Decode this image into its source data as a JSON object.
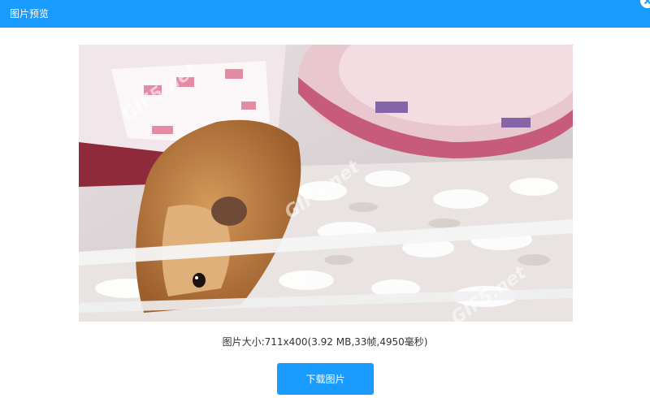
{
  "header": {
    "title": "图片预览"
  },
  "preview": {
    "watermark": "GIF5.net",
    "info_text": "图片大小:711x400(3.92 MB,33帧,4950毫秒)"
  },
  "actions": {
    "download_label": "下载图片"
  },
  "colors": {
    "accent": "#1a9bff"
  },
  "icons": {
    "close": "close-icon"
  }
}
